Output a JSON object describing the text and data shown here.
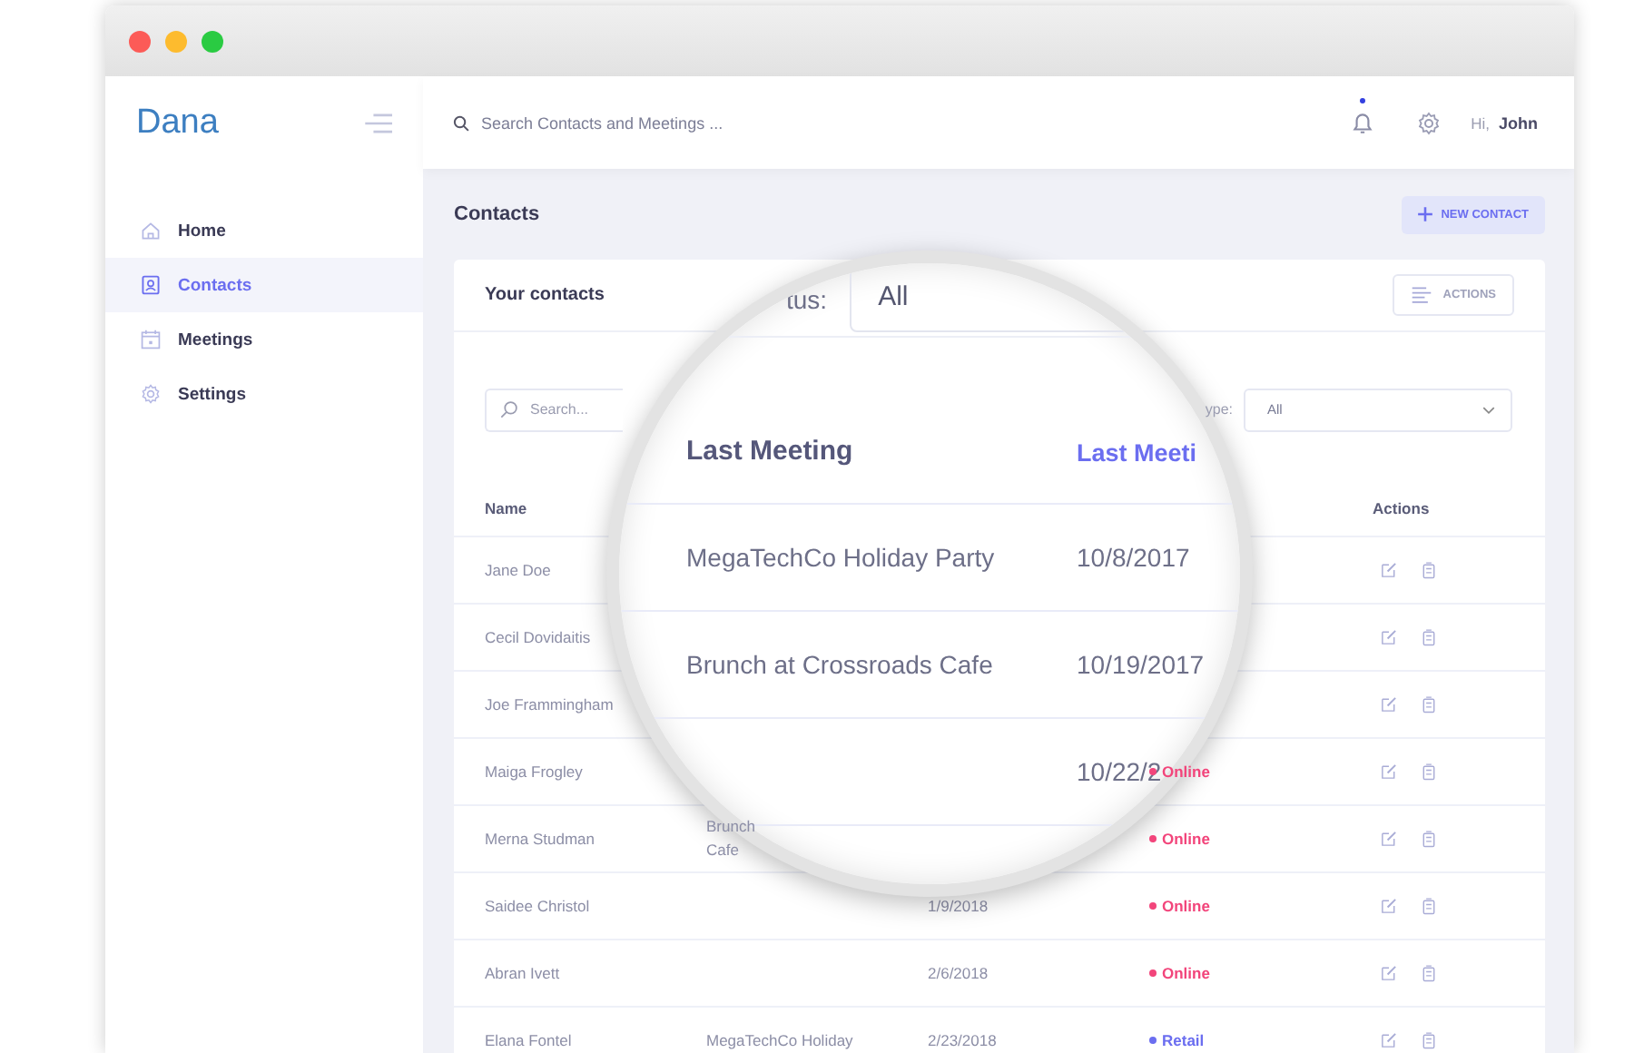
{
  "sidebar": {
    "logo": "Dana",
    "items": [
      {
        "label": "Home",
        "selected": false
      },
      {
        "label": "Contacts",
        "selected": true
      },
      {
        "label": "Meetings",
        "selected": false
      },
      {
        "label": "Settings",
        "selected": false
      }
    ]
  },
  "topbar": {
    "search": {
      "placeholder": "Search Contacts and Meetings ..."
    },
    "has_notification": true,
    "greeting": "Hi,",
    "user": "John"
  },
  "page": {
    "title": "Contacts",
    "new_button": "NEW CONTACT"
  },
  "card": {
    "title": "Your contacts",
    "actions_button": "ACTIONS",
    "search": {
      "placeholder": "Search..."
    },
    "type_filter": {
      "label": "ype:",
      "value": "All"
    }
  },
  "table": {
    "columns": {
      "name": "Name",
      "actions": "Actions"
    },
    "rows": [
      {
        "name": "Jane Doe"
      },
      {
        "name": "Cecil Dovidaitis"
      },
      {
        "name": "Joe Frammingham"
      },
      {
        "name": "Maiga Frogley",
        "status": {
          "text": "Online",
          "color": "#f2457b"
        }
      },
      {
        "name": "Merna Studman",
        "meeting": [
          "Brunch",
          "Cafe"
        ],
        "status": {
          "text": "Online",
          "color": "#f2457b"
        }
      },
      {
        "name": "Saidee Christol",
        "date": "1/9/2018",
        "status": {
          "text": "Online",
          "color": "#f2457b"
        }
      },
      {
        "name": "Abran Ivett",
        "date": "2/6/2018",
        "status": {
          "text": "Online",
          "color": "#f2457b"
        }
      },
      {
        "name": "Elana Fontel",
        "meeting": [
          "MegaTechCo Holiday"
        ],
        "date": "2/23/2018",
        "status": {
          "text": "Retail",
          "color": "#6b6ef0"
        }
      }
    ]
  },
  "magnifier": {
    "status_label": "tus:",
    "status_value": "All",
    "columns": [
      {
        "label": "Last Meeting",
        "selected": false
      },
      {
        "label": "Last Meeti",
        "selected": true
      }
    ],
    "rows": [
      {
        "meeting": "MegaTechCo Holiday Party",
        "date": "10/8/2017"
      },
      {
        "meeting": "Brunch at Crossroads Cafe",
        "date": "10/19/2017"
      },
      {
        "date": "10/22/2"
      }
    ]
  }
}
